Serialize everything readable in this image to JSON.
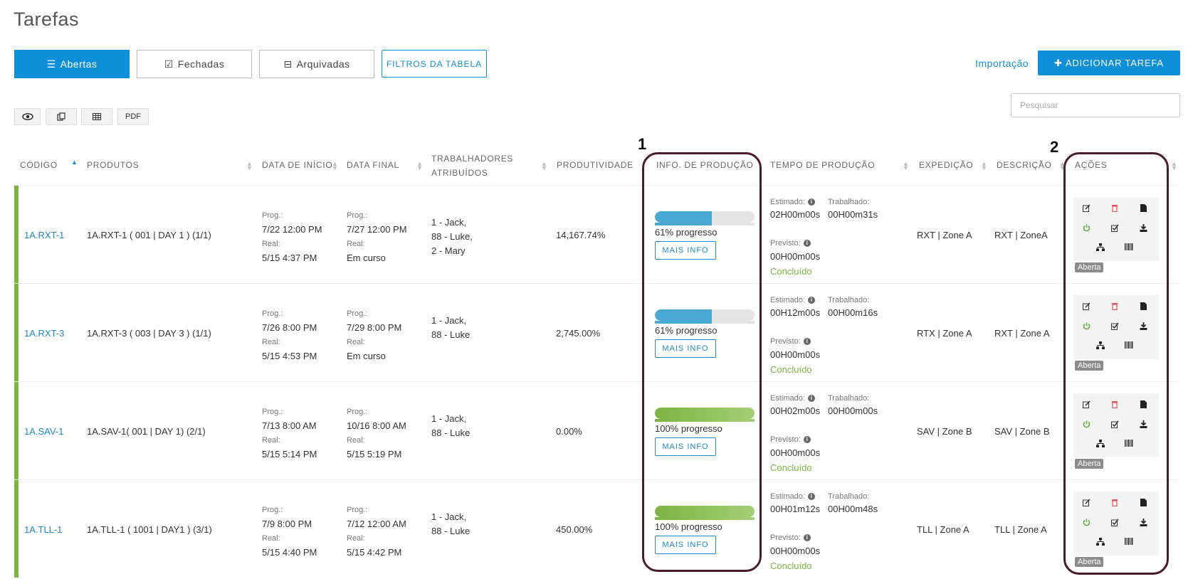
{
  "page": {
    "title": "Tarefas"
  },
  "tabs": [
    {
      "label": "Abertas",
      "icon": "list-icon"
    },
    {
      "label": "Fechadas",
      "icon": "checkbox-icon"
    },
    {
      "label": "Arquivadas",
      "icon": "inbox-icon"
    }
  ],
  "filter_button": "FILTROS DA TABELA",
  "import_link": "Importação",
  "add_button": "ADICIONAR TAREFA",
  "toolbar": {
    "view_icon": "eye-icon",
    "copy_icon": "copy-icon",
    "table_icon": "table-icon",
    "pdf_label": "PDF"
  },
  "search": {
    "placeholder": "Pesquisar"
  },
  "columns": {
    "code": "CÓDIGO",
    "products": "PRODUTOS",
    "start": "DATA DE INÍCIO",
    "end": "DATA FINAL",
    "workers_1": "TRABALHADORES",
    "workers_2": "ATRIBUÍDOS",
    "productivity": "PRODUTIVIDADE",
    "production_info": "INFO. DE PRODUÇÃO",
    "production_time": "TEMPO DE PRODUÇÃO",
    "expedition": "EXPEDIÇÃO",
    "description": "DESCRIÇÃO",
    "actions": "AÇÕES"
  },
  "labels": {
    "prog": "Prog.:",
    "real": "Real:",
    "estimated": "Estimado:",
    "worked": "Trabalhado:",
    "expected": "Previsto:",
    "more_info": "MAIS INFO"
  },
  "callouts": {
    "one": "1",
    "two": "2"
  },
  "colors": {
    "accent": "#0e8fd8",
    "row_bar": "#7cb342",
    "progress_partial": "#4aaad4",
    "progress_full": "#7cb342",
    "callout_border": "#4a1a2e"
  },
  "rows": [
    {
      "code": "1A.RXT-1",
      "product": "1A.RXT-1 ( 001 | DAY 1 ) (1/1)",
      "start_prog": "7/22   12:00 PM",
      "start_real": "5/15   4:37 PM",
      "end_prog": "7/27   12:00 PM",
      "end_real": "Em curso",
      "workers": [
        "1 - Jack,",
        "88 - Luke,",
        "2 - Mary"
      ],
      "productivity": "14,167.74%",
      "progress_fraction": 0.61,
      "progress_label": "61% progresso",
      "estimated": "02H00m00s",
      "worked": "00H00m31s",
      "expected": "00H00m00s",
      "status": "Concluído",
      "expedition": "RXT | Zone A",
      "description": "RXT | ZoneA",
      "badge": "Aberta"
    },
    {
      "code": "1A.RXT-3",
      "product": "1A.RXT-3 ( 003 | DAY 3 ) (1/1)",
      "start_prog": "7/26   8:00 PM",
      "start_real": "5/15   4:53 PM",
      "end_prog": "7/29   8:00 PM",
      "end_real": "Em curso",
      "workers": [
        "1 - Jack,",
        "88 - Luke"
      ],
      "productivity": "2,745.00%",
      "progress_fraction": 0.61,
      "progress_label": "61% progresso",
      "estimated": "00H12m00s",
      "worked": "00H00m16s",
      "expected": "00H00m00s",
      "status": "Concluído",
      "expedition": "RTX | Zone A",
      "description": "RXT | Zone A",
      "badge": "Aberta"
    },
    {
      "code": "1A.SAV-1",
      "product": "1A.SAV-1( 001 | DAY 1) (2/1)",
      "start_prog": "7/13   8:00 AM",
      "start_real": "5/15   5:14 PM",
      "end_prog": "10/16   8:00 AM",
      "end_real": "5/15   5:19 PM",
      "workers": [
        "1 - Jack,",
        "88 - Luke"
      ],
      "productivity": "0.00%",
      "progress_fraction": 1.0,
      "progress_label": "100% progresso",
      "estimated": "00H02m00s",
      "worked": "00H00m00s",
      "expected": "00H00m00s",
      "status": "Concluído",
      "expedition": "SAV | Zone B",
      "description": "SAV | Zone B",
      "badge": "Aberta"
    },
    {
      "code": "1A.TLL-1",
      "product": "1A.TLL-1 ( 1001 | DAY1 ) (3/1)",
      "start_prog": "7/9   8:00 PM",
      "start_real": "5/15   4:40 PM",
      "end_prog": "7/12   12:00 AM",
      "end_real": "5/15   4:42 PM",
      "workers": [
        "1 - Jack,",
        "88 - Luke"
      ],
      "productivity": "450.00%",
      "progress_fraction": 1.0,
      "progress_label": "100% progresso",
      "estimated": "00H01m12s",
      "worked": "00H00m48s",
      "expected": "00H00m00s",
      "status": "Concluído",
      "expedition": "TLL | Zone A",
      "description": "TLL | Zone A",
      "badge": "Aberta"
    }
  ]
}
